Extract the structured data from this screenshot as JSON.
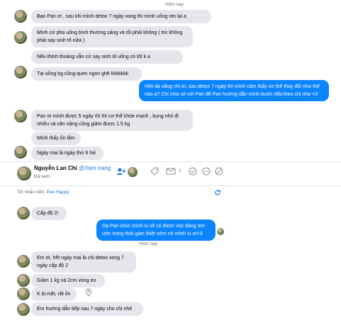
{
  "top_chat": {
    "date_label": "Hôm nay",
    "messages": [
      {
        "text": "Bạn Pan ơi , sau khi mình detox 7 ngày xong thì mình uống ntn lại a"
      },
      {
        "text": "Mình cứ pha uống bình thường sáng và tối phải không ( trừ không phải say sinh tố nữa )"
      },
      {
        "text": "Nếu thỉnh thoảng vẫn cứ say sinh tố uống có tốt k a"
      },
      {
        "text": "Tại uống bg cũng quen ngon ghê kkkkkkk"
      },
      {
        "text": "Hihi dạ vâng chị ơi, sau detox 7 ngày thì mình cảm thấy cơ thể thay đổi như thế nào ạ? Chị chia sẻ với Pan để Pan hướng dẫn mình bước tiếp theo chị nha <3"
      },
      {
        "text": "Pan ơi mình được 5 ngày rồi thì cơ thể khỏe mạnh , bụng nhỏ đi nhiều và cân nặng cũng giảm được 1.5 kg"
      },
      {
        "text": "Mình thấy ổn lắm"
      },
      {
        "text": "Ngày mai là ngày thứ 6 hiii"
      }
    ]
  },
  "bottom_chat": {
    "header": {
      "name": "Nguyễn Lan Chi",
      "profile_link": "@Xem trang",
      "status": "Đã xem",
      "label_count": "1"
    },
    "source_label": "Tin nhắn trên:",
    "source_page": "Pan Happy",
    "date_label": "Hôm nay",
    "messages": [
      {
        "text": "Cấp độ 2!"
      },
      {
        "text": "Dạ Pan chúc mình iu sẽ có được vóc dáng mơ ước trong thời gian thiệt sớm nè mình iu ơi<3"
      },
      {
        "text": "Em ơi, hết ngày mai là chị detox xong 7 ngày cấp độ 2"
      },
      {
        "text": "Giảm 1 kg và 2cm vòng eo"
      },
      {
        "text": "K bị mệt, rất ổn"
      },
      {
        "text": "Em hướng dẫn tiếp sau 7 ngày cho chị nhé"
      }
    ]
  },
  "colors": {
    "own_bubble": "#0b84ff",
    "other_bubble": "#e4e6eb",
    "link": "#1a73e8"
  },
  "icons": [
    "add-person-icon",
    "tag-icon",
    "mail-icon",
    "check-circle-icon",
    "more-icon",
    "block-icon",
    "refresh-icon",
    "location-icon"
  ]
}
